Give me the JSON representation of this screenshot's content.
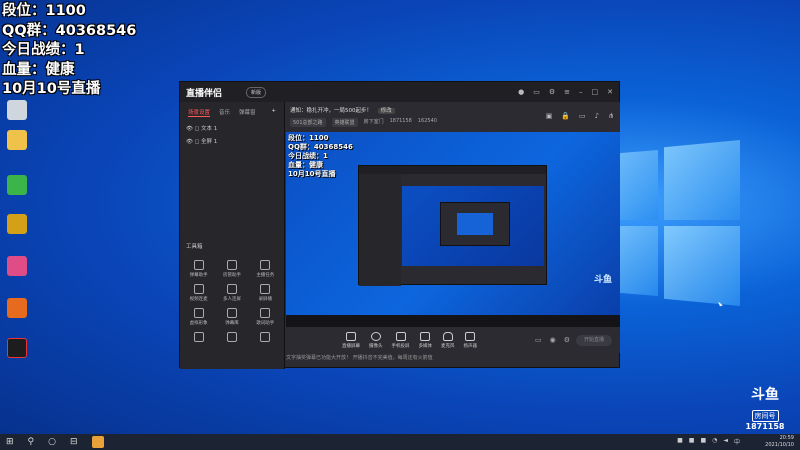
{
  "overlay": {
    "line1": "段位：1100",
    "line2": "QQ群：40368546",
    "line3": "今日战绩：1",
    "line4": "血量：健康",
    "line5": "10月10号直播"
  },
  "desktop_icons": [
    {
      "name": "recycle",
      "label": "",
      "color": "#ccc"
    },
    {
      "name": "folder",
      "label": "",
      "color": "#f1c24a"
    },
    {
      "name": "gpu",
      "label": "",
      "color": "#3bb54a"
    },
    {
      "name": "game",
      "label": "",
      "color": "#d4a017"
    },
    {
      "name": "app-pink",
      "label": "",
      "color": "#e04d86"
    },
    {
      "name": "app-orange",
      "label": "",
      "color": "#e66b1e"
    },
    {
      "name": "app-red",
      "label": "",
      "color": "#1d1d1d"
    }
  ],
  "app": {
    "logo": "直播伴侣",
    "badge": "新版",
    "tabs": [
      "场景设置",
      "音乐",
      "弹幕窗"
    ],
    "scenes": [
      "文本 1",
      "全屏 1"
    ],
    "tools_title": "工具箱",
    "tools": [
      "弹幕助手",
      "房管助手",
      "主播任务",
      "视频连麦",
      "多人连屏",
      "录屏播",
      "虚拟形象",
      "弹幕库",
      "歌词助手",
      "",
      "",
      ""
    ],
    "notice": "文字抽奖弹幕已功能大开放！ 开播抖音不完美值，每周还有火箭值",
    "announce": "通知：稳扎开冲，一局500起步！",
    "announce_pill": "修改",
    "meta": {
      "chip1": "501总部之路",
      "chip2": "英雄联盟",
      "share": "房下室门",
      "room": "1871158",
      "hot": "162540"
    },
    "bottom": [
      "直播屏幕",
      "摄像头",
      "手机投屏",
      "多媒体",
      "麦克风",
      "扬声器"
    ],
    "start_label": "开始直播"
  },
  "preview_overlay": {
    "l1": "段位：1100",
    "l2": "QQ群：40368546",
    "l3": "今日战绩：1",
    "l4": "血量：健康",
    "l5": "10月10号直播"
  },
  "douyu": {
    "logo": "斗鱼",
    "room_label": "房间号",
    "room": "1871158"
  },
  "clock": {
    "time": "20:59",
    "date": "2021/10/10"
  }
}
